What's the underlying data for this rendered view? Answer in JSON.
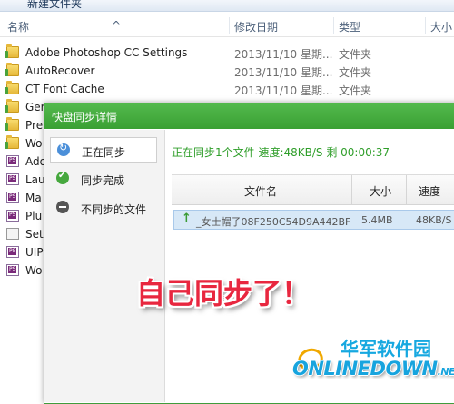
{
  "toolbar": {
    "new_folder_label": "新建文件夹"
  },
  "columns": {
    "name": "名称",
    "date": "修改日期",
    "type": "类型",
    "size": "大小"
  },
  "files": [
    {
      "name": "Adobe Photoshop CC Settings",
      "date": "2013/11/10 星期...",
      "type": "文件夹",
      "icon": "folder-icon"
    },
    {
      "name": "AutoRecover",
      "date": "2013/11/10 星期...",
      "type": "文件夹",
      "icon": "folder-icon"
    },
    {
      "name": "CT Font Cache",
      "date": "2013/11/10 星期...",
      "type": "文件夹",
      "icon": "folder-icon"
    },
    {
      "name": "Ger",
      "icon": "folder-icon"
    },
    {
      "name": "Pre",
      "icon": "folder-icon"
    },
    {
      "name": "Wo",
      "icon": "folder-icon"
    },
    {
      "name": "Ado",
      "icon": "psp-file-icon"
    },
    {
      "name": "Lau",
      "icon": "psp-file-icon"
    },
    {
      "name": "Ma",
      "icon": "psp-file-icon"
    },
    {
      "name": "Plu",
      "icon": "psp-file-icon"
    },
    {
      "name": "Set",
      "icon": "file-icon"
    },
    {
      "name": "UIP",
      "icon": "psp-file-icon"
    },
    {
      "name": "Wo",
      "icon": "psp-file-icon"
    }
  ],
  "dialog": {
    "title": "快盘同步详情",
    "nav": [
      {
        "label": "正在同步",
        "icon": "sync-icon",
        "active": true
      },
      {
        "label": "同步完成",
        "icon": "check-icon",
        "active": false
      },
      {
        "label": "不同步的文件",
        "icon": "minus-icon",
        "active": false
      }
    ],
    "status_text": "正在同步1个文件 速度:48KB/S 剩 00:00:37",
    "table": {
      "headers": [
        "文件名",
        "大小",
        "速度"
      ],
      "rows": [
        {
          "name": "_女士帽子08F250C54D9A442BF",
          "size": "5.4MB",
          "speed": "48KB/S",
          "direction_icon": "upload-arrow-icon"
        }
      ]
    }
  },
  "caption": "自己同步了！",
  "watermark": {
    "cn": "华军软件园",
    "en": "ONLINEDOWN",
    "tld": ".NET"
  },
  "colors": {
    "accent_green": "#3aa033",
    "caption_red": "#e8273f",
    "watermark_blue": "#16a8e0"
  }
}
